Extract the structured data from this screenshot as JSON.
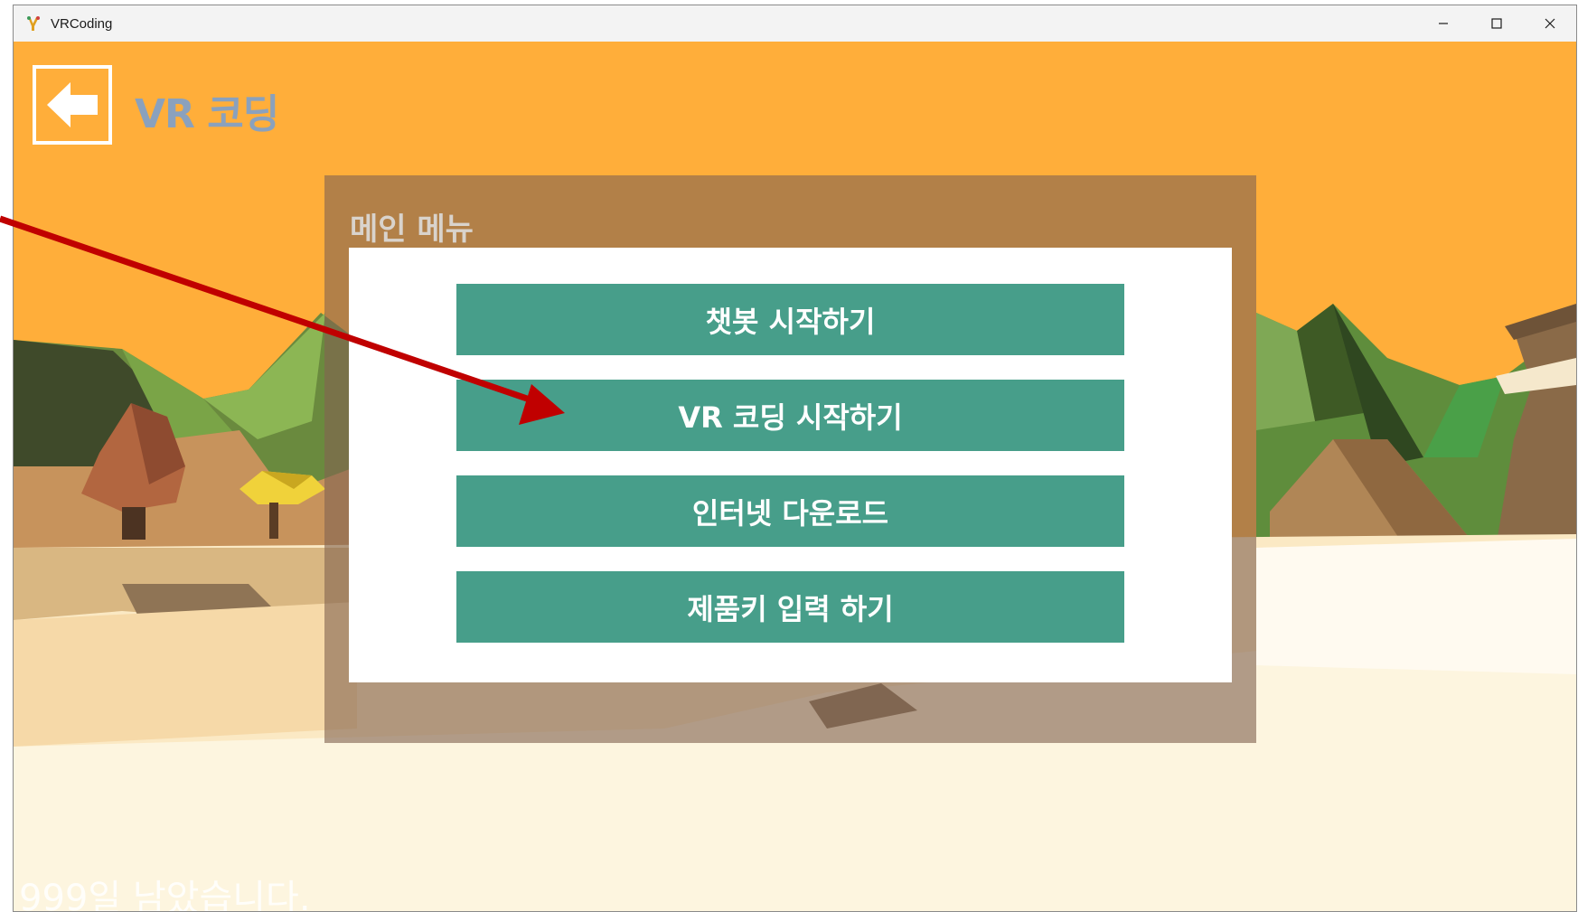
{
  "window": {
    "title": "VRCoding",
    "icon": "app-icon",
    "controls": [
      "minimize-icon",
      "maximize-icon",
      "close-icon"
    ]
  },
  "header": {
    "back_icon": "left-arrow-icon",
    "title": "VR 코딩"
  },
  "menu": {
    "title": "메인 메뉴",
    "buttons": [
      {
        "label": "챗봇 시작하기"
      },
      {
        "label": "VR 코딩 시작하기"
      },
      {
        "label": "인터넷 다운로드"
      },
      {
        "label": "제품키 입력 하기"
      }
    ]
  },
  "status": {
    "days_left": "999일 남았습니다."
  },
  "colors": {
    "sky": "#ffae3a",
    "button": "#479e8a",
    "panel": "#a5804a",
    "annotation_arrow": "#c00000",
    "title_text": "#8aa1bd"
  }
}
